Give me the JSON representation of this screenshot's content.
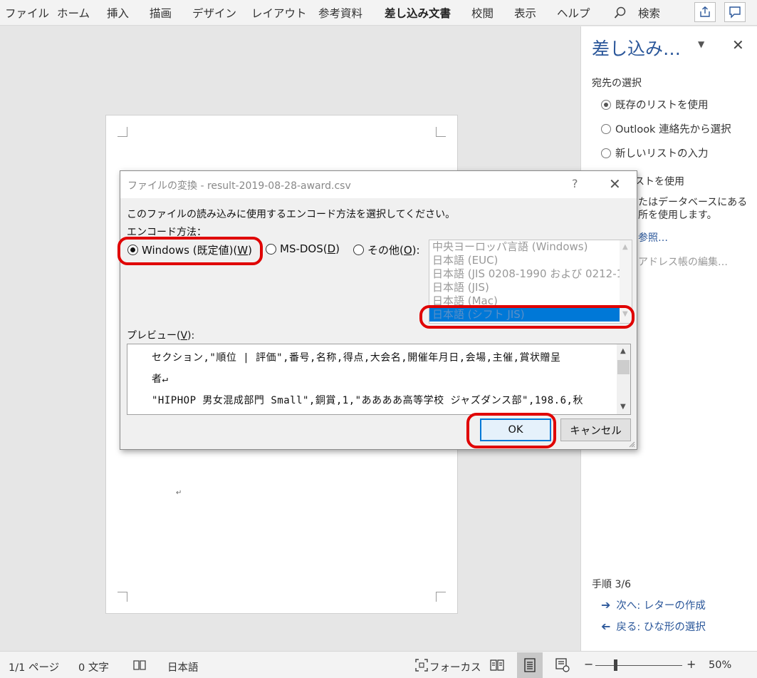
{
  "ribbon": {
    "tabs": [
      "ファイル",
      "ホーム",
      "挿入",
      "描画",
      "デザイン",
      "レイアウト",
      "参考資料",
      "差し込み文書",
      "校閲",
      "表示",
      "ヘルプ"
    ],
    "active_tab": "差し込み文書",
    "search_label": "検索",
    "share_icon": "share-icon",
    "comments_icon": "comment-icon"
  },
  "task_pane": {
    "title": "差し込み…",
    "section_recipients": "宛先の選択",
    "options": [
      "既存のリストを使用",
      "Outlook 連絡先から選択",
      "新しいリストの入力"
    ],
    "selected_option": "既存のリストを使用",
    "section_use": "ストを使用",
    "desc_line1": "たはデータベースにある",
    "desc_line2": "所を使用します。",
    "link_browse": "参照…",
    "link_edit": "アドレス帳の編集…",
    "step": "手順 3/6",
    "next": "次へ: レターの作成",
    "back": "戻る: ひな形の選択"
  },
  "dialog": {
    "title": "ファイルの変換 - result-2019-08-28-award.csv",
    "help": "?",
    "instruction": "このファイルの読み込みに使用するエンコード方法を選択してください。",
    "encoding_label": "エンコード方法：",
    "radio_windows": "Windows (既定値)(",
    "radio_windows_key": "W",
    "radio_msdos": "MS-DOS(",
    "radio_msdos_key": "D",
    "radio_other": "その他(",
    "radio_other_key": "O",
    "radio_suffix": ")",
    "radio_other_suffix": "):",
    "selected_radio": "Windows",
    "encodings": [
      "中央ヨーロッパ言語 (Windows)",
      "日本語 (EUC)",
      "日本語 (JIS 0208-1990 および 0212-1",
      "日本語 (JIS)",
      "日本語 (Mac)",
      "日本語 (シフト JIS)"
    ],
    "selected_encoding": "日本語 (シフト JIS)",
    "preview_label": "プレビュー(",
    "preview_key": "V",
    "preview_suffix": "):",
    "preview_lines": [
      "セクション,\"順位 | 評価\",番号,名称,得点,大会名,開催年月日,会場,主催,賞状贈呈",
      "者↵",
      "\"HIPHOP 男女混成部門 Small\",銅賞,1,\"ああああ高等学校 ジャズダンス部\",198.6,秋"
    ],
    "ok": "OK",
    "cancel": "キャンセル"
  },
  "document": {
    "para_mark": "↵"
  },
  "status_bar": {
    "page": "1/1 ページ",
    "words": "0 文字",
    "language": "日本語",
    "focus": "フォーカス",
    "zoom": "50%",
    "zoom_minus": "−",
    "zoom_plus": "+"
  },
  "colors": {
    "accent": "#2b579a",
    "highlight": "#e00000",
    "selection": "#0078d7"
  }
}
